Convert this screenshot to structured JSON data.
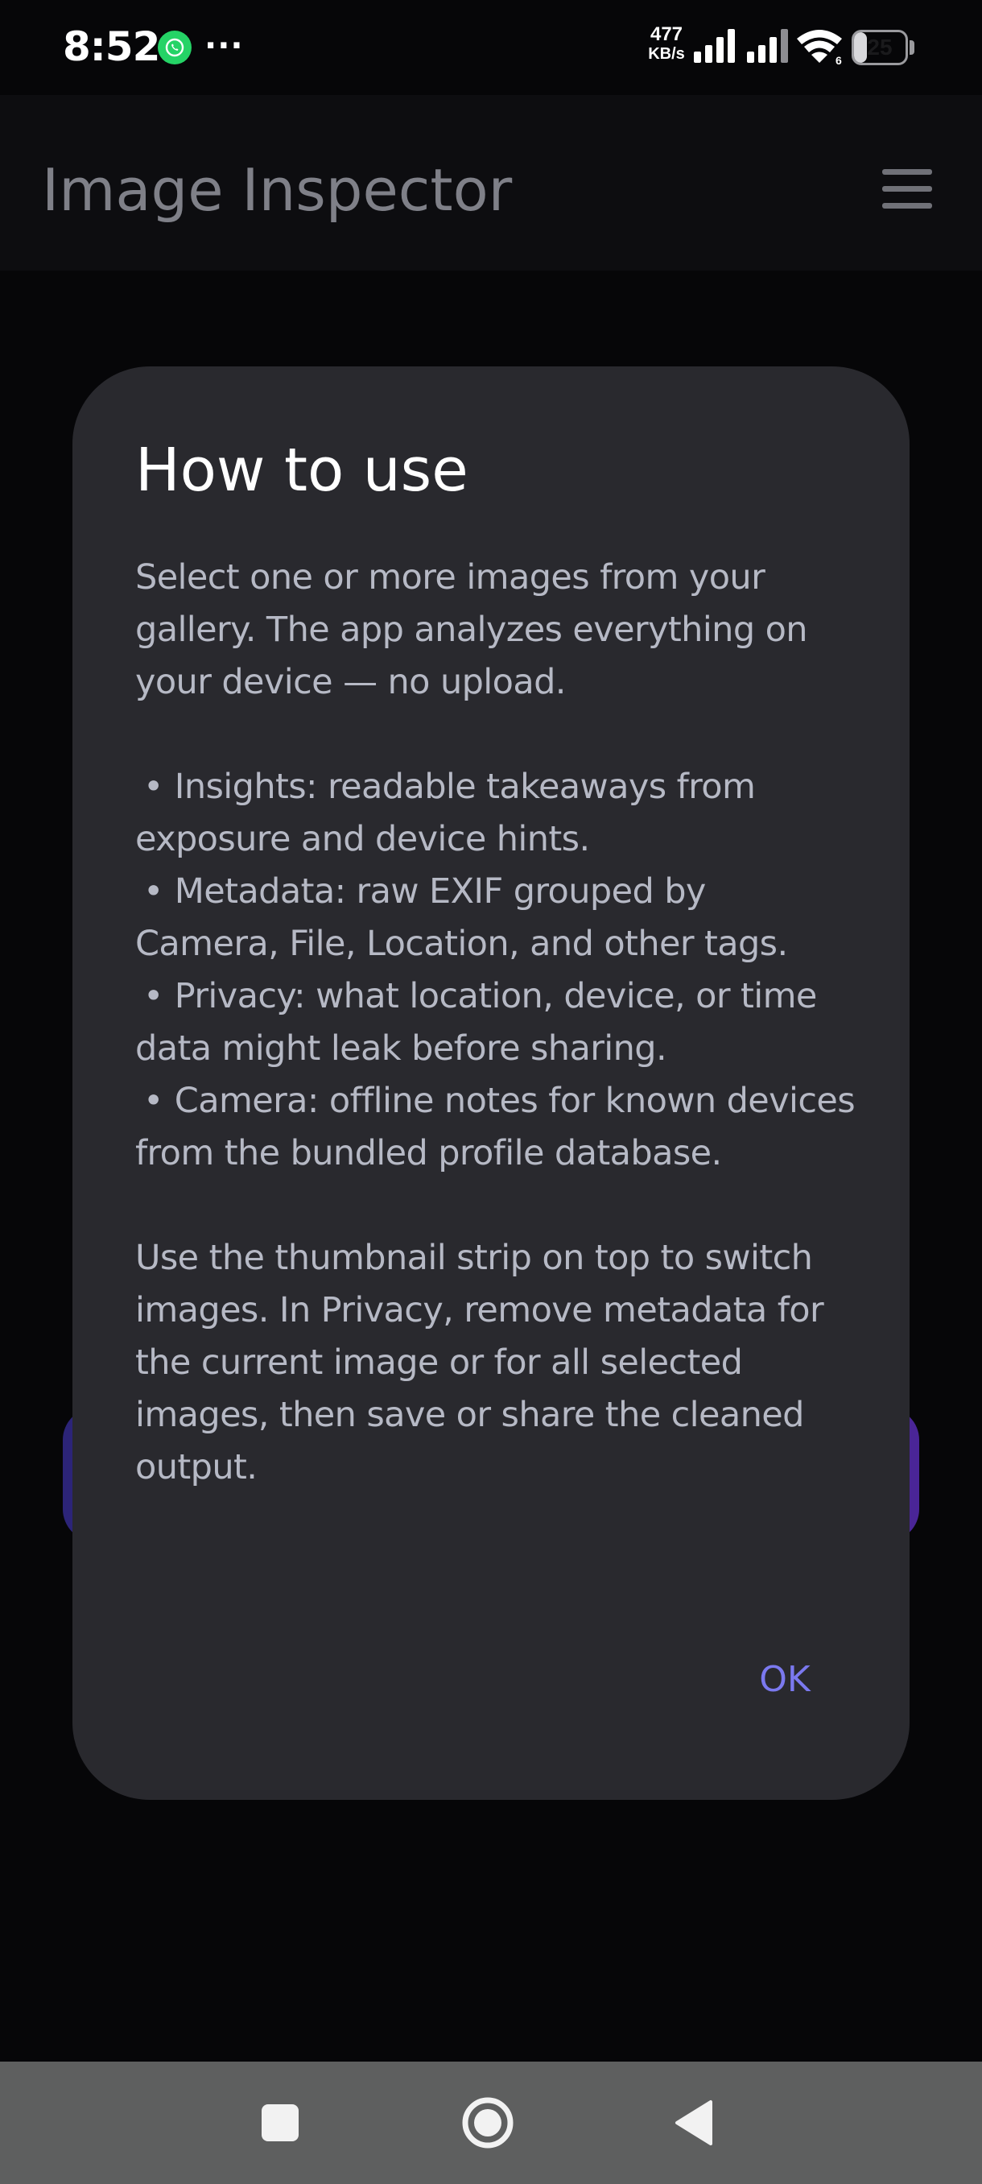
{
  "status_bar": {
    "time": "8:52",
    "dots": "···",
    "network_speed_value": "477",
    "network_speed_unit": "KB/s",
    "battery_level": "25",
    "battery_fraction": 0.25
  },
  "app_bar": {
    "title": "Image Inspector",
    "menu_icon": "hamburger-menu-icon"
  },
  "dialog": {
    "title": "How to use",
    "intro": "Select one or more images from your gallery. The app analyzes everything on your device — no upload.",
    "bullets": [
      "Insights: readable takeaways from exposure and device hints.",
      "Metadata: raw EXIF grouped by Camera, File, Location, and other tags.",
      "Privacy: what location, device, or time data might leak before sharing.",
      "Camera: offline notes for known devices from the bundled profile database."
    ],
    "bullet_marker": "•",
    "outro": "Use the thumbnail strip on top to switch images. In Privacy, remove metadata for the current image or for all selected images, then save or share the cleaned output.",
    "ok_label": "OK"
  },
  "nav_bar": {
    "icons": [
      "recents-square-icon",
      "home-circle-icon",
      "back-triangle-icon"
    ]
  },
  "colors": {
    "background": "#060608",
    "app_bar": "#0d0d10",
    "dialog": "#29292e",
    "accent": "#7b79ef",
    "body_text": "#b6b9c5",
    "nav_bar": "#5e5f5f",
    "whatsapp_green": "#25d366"
  }
}
